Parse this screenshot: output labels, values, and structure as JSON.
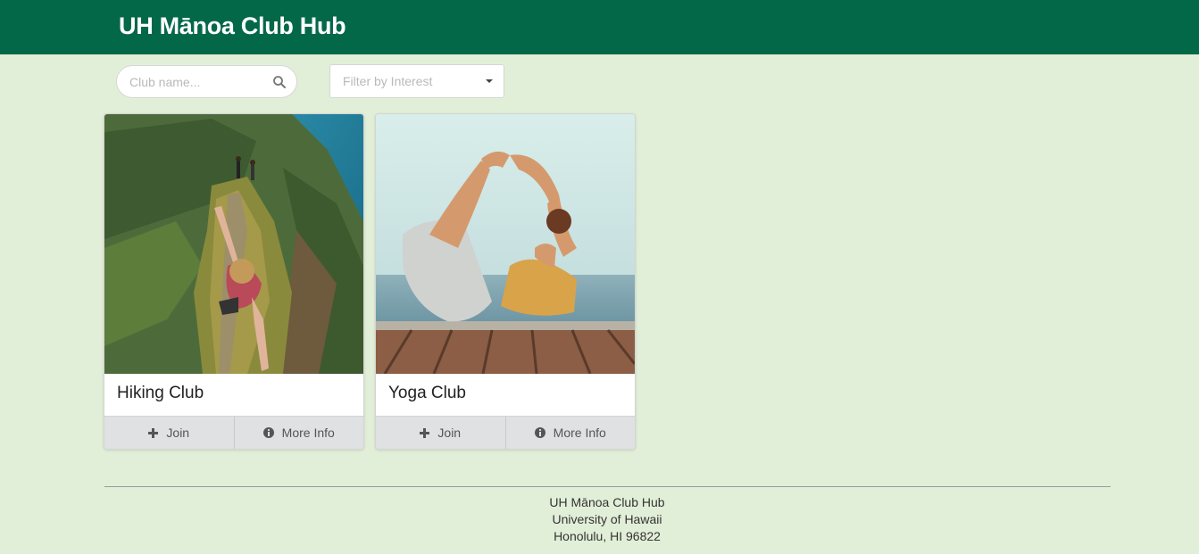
{
  "header": {
    "title": "UH Mānoa Club Hub",
    "bg_color": "#036848"
  },
  "search": {
    "placeholder": "Club name...",
    "value": "",
    "icon": "search-icon"
  },
  "filter": {
    "placeholder": "Filter by Interest",
    "icon": "caret-down-icon"
  },
  "cards": [
    {
      "title": "Hiking Club",
      "image": "photo of a hiker on a green mountain ridge",
      "join_label": "Join",
      "join_icon": "plus-icon",
      "info_label": "More Info",
      "info_icon": "info-circle-icon"
    },
    {
      "title": "Yoga Club",
      "image": "photo of a woman in a bow yoga pose on a wooden deck by the sea",
      "join_label": "Join",
      "join_icon": "plus-icon",
      "info_label": "More Info",
      "info_icon": "info-circle-icon"
    }
  ],
  "footer": {
    "line1": "UH Mānoa Club Hub",
    "line2": "University of Hawaii",
    "line3": "Honolulu, HI 96822"
  },
  "colors": {
    "page_bg": "#e2efd8",
    "header": "#036848",
    "card_actions": "#e0e1e2"
  }
}
